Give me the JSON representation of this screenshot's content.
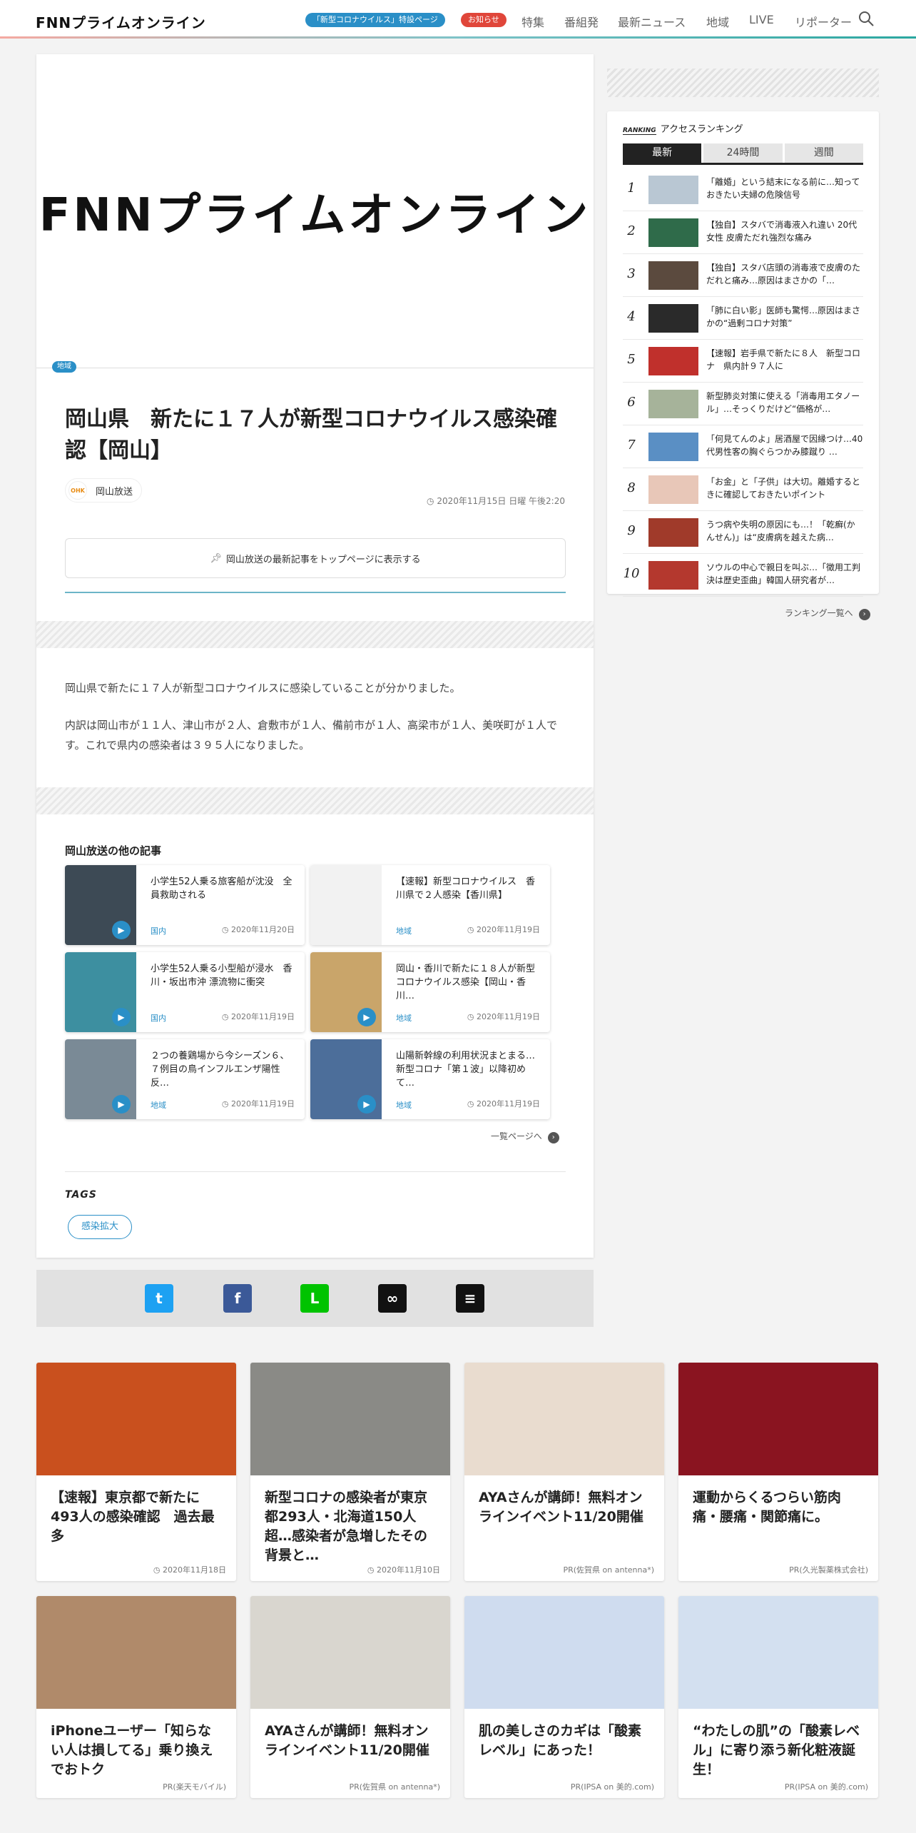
{
  "header": {
    "logo_text": "FNNプライムオンライン",
    "special_label": "「新型コロナウイルス」特設ページ",
    "notice_label": "お知らせ",
    "nav": [
      "特集",
      "番組発",
      "最新ニュース",
      "地域",
      "LIVE",
      "リポーター"
    ]
  },
  "article": {
    "hero_logo": "FNNプライムオンライン",
    "category": "地域",
    "title": "岡山県　新たに１７人が新型コロナウイルス感染確認【岡山】",
    "source_logo": "OHK",
    "source_name": "岡山放送",
    "date": "2020年11月15日 日曜 午後2:20",
    "pin_label": "岡山放送の最新記事をトップページに表示する",
    "paragraphs": [
      "岡山県で新たに１７人が新型コロナウイルスに感染していることが分かりました。",
      "内訳は岡山市が１１人、津山市が２人、倉敷市が１人、備前市が１人、高梁市が１人、美咲町が１人です。これで県内の感染者は３９５人になりました。"
    ]
  },
  "related": {
    "title": "岡山放送の他の記事",
    "items": [
      {
        "title": "小学生52人乗る旅客船が沈没　全員救助される",
        "category": "国内",
        "date": "2020年11月20日",
        "video": true,
        "thumb": "#3d4a55"
      },
      {
        "title": "【速報】新型コロナウイルス　香川県で２人感染【香川県】",
        "category": "地域",
        "date": "2020年11月19日",
        "video": false,
        "thumb": "#f2f2f2"
      },
      {
        "title": "小学生52人乗る小型船が浸水　香川・坂出市沖 漂流物に衝突",
        "category": "国内",
        "date": "2020年11月19日",
        "video": true,
        "thumb": "#3d8fa0"
      },
      {
        "title": "岡山・香川で新たに１８人が新型コロナウイルス感染【岡山・香川…",
        "category": "地域",
        "date": "2020年11月19日",
        "video": true,
        "thumb": "#c9a56a"
      },
      {
        "title": "２つの養鶏場から今シーズン６、７例目の鳥インフルエンザ陽性反…",
        "category": "地域",
        "date": "2020年11月19日",
        "video": true,
        "thumb": "#7a8a96"
      },
      {
        "title": "山陽新幹線の利用状況まとまる…新型コロナ「第１波」以降初めて…",
        "category": "地域",
        "date": "2020年11月19日",
        "video": true,
        "thumb": "#4c6e9a"
      }
    ],
    "more_label": "一覧ページへ"
  },
  "tags": {
    "title": "TAGS",
    "items": [
      "感染拡大"
    ]
  },
  "share": {
    "buttons": [
      {
        "name": "twitter",
        "glyph": "t",
        "color": "#1da1f2"
      },
      {
        "name": "facebook",
        "glyph": "f",
        "color": "#3b5998"
      },
      {
        "name": "line",
        "glyph": "L",
        "color": "#00c300"
      },
      {
        "name": "link",
        "glyph": "∞",
        "color": "#111111"
      },
      {
        "name": "comment",
        "glyph": "≡",
        "color": "#111111"
      }
    ]
  },
  "ranking": {
    "badge": "RANKING",
    "title": "アクセスランキング",
    "tabs": [
      "最新",
      "24時間",
      "週間"
    ],
    "active_tab": 0,
    "items": [
      {
        "rank": "1",
        "text": "「離婚」という結末になる前に…知っておきたい夫婦の危険信号",
        "thumb": "#b9c7d3"
      },
      {
        "rank": "2",
        "text": "【独自】スタバで消毒液入れ違い 20代女性 皮膚ただれ強烈な痛み",
        "thumb": "#2f6b4a"
      },
      {
        "rank": "3",
        "text": "【独自】スタバ店頭の消毒液で皮膚のただれと痛み…原因はまさかの「…",
        "thumb": "#5b4a3e"
      },
      {
        "rank": "4",
        "text": "「肺に白い影」医師も驚愕…原因はまさかの“過剰コロナ対策”",
        "thumb": "#2a2a2a"
      },
      {
        "rank": "5",
        "text": "【速報】岩手県で新たに８人　新型コロナ　県内計９７人に",
        "thumb": "#c0302c"
      },
      {
        "rank": "6",
        "text": "新型肺炎対策に使える「消毒用エタノール」…そっくりだけど“価格が…",
        "thumb": "#a6b39a"
      },
      {
        "rank": "7",
        "text": "「何見てんのよ」居酒屋で因縁つけ…40代男性客の胸ぐらつかみ膝蹴り …",
        "thumb": "#5a8fc4"
      },
      {
        "rank": "8",
        "text": "「お金」と「子供」は大切。離婚するときに確認しておきたいポイント",
        "thumb": "#e8c7b8"
      },
      {
        "rank": "9",
        "text": "うつ病や失明の原因にも…！「乾癬(かんせん)」は“皮膚病を越えた病…",
        "thumb": "#a03a2a"
      },
      {
        "rank": "10",
        "text": "ソウルの中心で親日を叫ぶ…「徴用工判決は歴史歪曲」韓国人研究者が…",
        "thumb": "#b4382e"
      }
    ],
    "more_label": "ランキング一覧へ"
  },
  "grid": [
    {
      "title": "【速報】東京都で新たに493人の感染確認　過去最多",
      "meta": "2020年11月18日",
      "has_clock": true,
      "img": "#c9501e"
    },
    {
      "title": "新型コロナの感染者が東京都293人・北海道150人超…感染者が急増したその背景と…",
      "meta": "2020年11月10日",
      "has_clock": true,
      "img": "#8a8a86"
    },
    {
      "title": "AYAさんが講師！無料オンラインイベント11/20開催",
      "meta": "PR(佐賀県 on antenna*)",
      "has_clock": false,
      "img": "#e9dccf"
    },
    {
      "title": "運動からくるつらい筋肉痛・腰痛・関節痛に。",
      "meta": "PR(久光製薬株式会社)",
      "has_clock": false,
      "img": "#8a1420"
    },
    {
      "title": "iPhoneユーザー「知らない人は損してる」乗り換えでおトク",
      "meta": "PR(楽天モバイル)",
      "has_clock": false,
      "img": "#b08a6a"
    },
    {
      "title": "AYAさんが講師！無料オンラインイベント11/20開催",
      "meta": "PR(佐賀県 on antenna*)",
      "has_clock": false,
      "img": "#d9d6cf"
    },
    {
      "title": "肌の美しさのカギは「酸素レベル」にあった！",
      "meta": "PR(IPSA on 美的.com)",
      "has_clock": false,
      "img": "#cfdcef"
    },
    {
      "title": "“わたしの肌”の「酸素レベル」に寄り添う新化粧液誕生！",
      "meta": "PR(IPSA on 美的.com)",
      "has_clock": false,
      "img": "#d3e0f0"
    }
  ]
}
